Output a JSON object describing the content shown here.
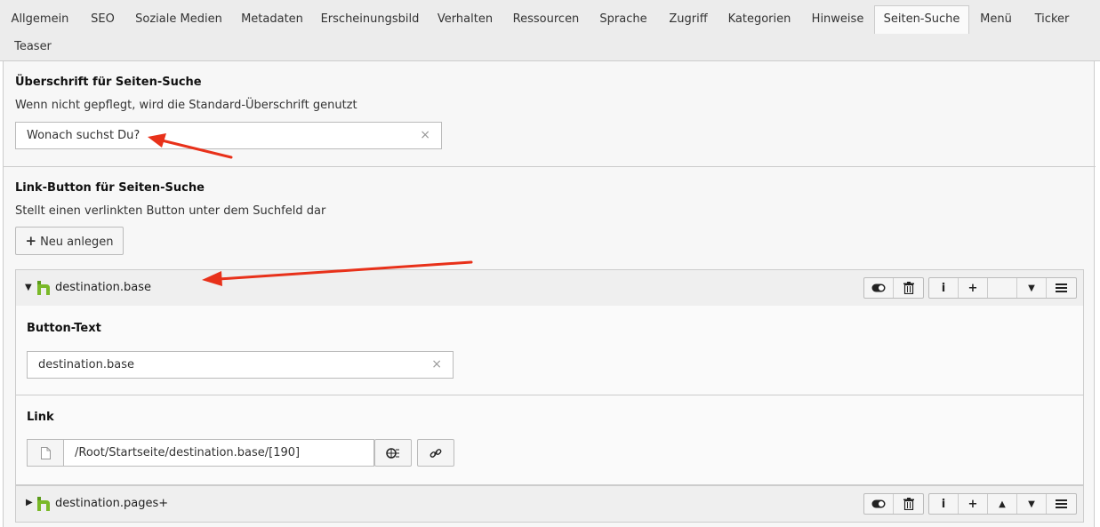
{
  "tabs": [
    {
      "label": "Allgemein"
    },
    {
      "label": "SEO"
    },
    {
      "label": "Soziale Medien"
    },
    {
      "label": "Metadaten"
    },
    {
      "label": "Erscheinungsbild"
    },
    {
      "label": "Verhalten"
    },
    {
      "label": "Ressourcen"
    },
    {
      "label": "Sprache"
    },
    {
      "label": "Zugriff"
    },
    {
      "label": "Kategorien"
    },
    {
      "label": "Hinweise"
    },
    {
      "label": "Seiten-Suche"
    },
    {
      "label": "Menü"
    },
    {
      "label": "Ticker"
    },
    {
      "label": "Teaser"
    }
  ],
  "active_tab": "Seiten-Suche",
  "heading_section": {
    "title": "Überschrift für Seiten-Suche",
    "description": "Wenn nicht gepflegt, wird die Standard-Überschrift genutzt",
    "value": "Wonach suchst Du?",
    "clear": "×"
  },
  "link_section": {
    "title": "Link-Button für Seiten-Suche",
    "description": "Stellt einen verlinkten Button unter dem Suchfeld dar",
    "new_button": "Neu anlegen",
    "new_icon": "+"
  },
  "records": [
    {
      "title": "destination.base",
      "button_text_label": "Button-Text",
      "button_text_value": "destination.base",
      "link_label": "Link",
      "link_value": "/Root/Startseite/destination.base/[190]"
    },
    {
      "title": "destination.pages+"
    }
  ],
  "controls": {
    "info": "i",
    "add": "+",
    "clear": "×"
  },
  "colors": {
    "annotation_arrow": "#e8311a",
    "record_icon": "#7ab929"
  }
}
